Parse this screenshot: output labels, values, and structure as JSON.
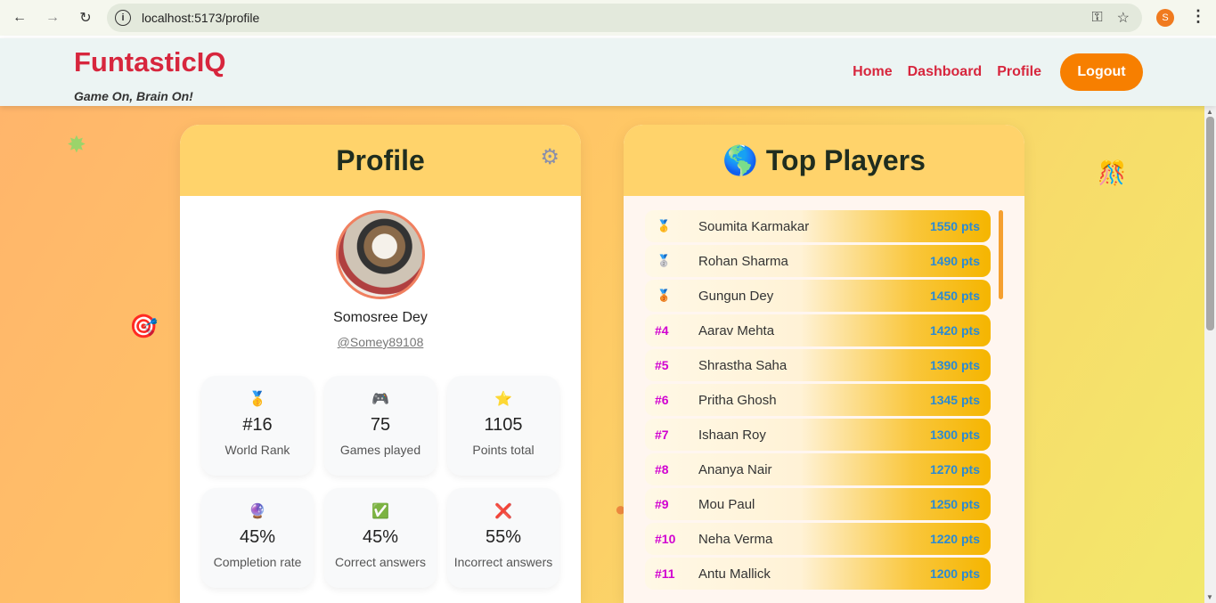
{
  "browser": {
    "url": "localhost:5173/profile",
    "profile_initial": "S"
  },
  "header": {
    "logo": "FuntasticIQ",
    "tagline": "Game On, Brain On!",
    "nav": [
      "Home",
      "Dashboard",
      "Profile"
    ],
    "logout": "Logout"
  },
  "profile": {
    "title": "Profile",
    "name": "Somosree Dey",
    "handle": "@Somey89108",
    "stats": [
      {
        "icon": "🥇",
        "value": "#16",
        "label": "World Rank"
      },
      {
        "icon": "🎮",
        "value": "75",
        "label": "Games played"
      },
      {
        "icon": "⭐",
        "value": "1105",
        "label": "Points total"
      },
      {
        "icon": "🔮",
        "value": "45%",
        "label": "Completion rate"
      },
      {
        "icon": "✅",
        "value": "45%",
        "label": "Correct answers"
      },
      {
        "icon": "❌",
        "value": "55%",
        "label": "Incorrect answers"
      }
    ]
  },
  "leaderboard": {
    "icon": "🌎",
    "title": "Top Players",
    "players": [
      {
        "rank": "🥇",
        "name": "Soumita Karmakar",
        "points": "1550 pts"
      },
      {
        "rank": "🥈",
        "name": "Rohan Sharma",
        "points": "1490 pts"
      },
      {
        "rank": "🥉",
        "name": "Gungun Dey",
        "points": "1450 pts"
      },
      {
        "rank": "#4",
        "name": "Aarav Mehta",
        "points": "1420 pts"
      },
      {
        "rank": "#5",
        "name": "Shrastha Saha",
        "points": "1390 pts"
      },
      {
        "rank": "#6",
        "name": "Pritha Ghosh",
        "points": "1345 pts"
      },
      {
        "rank": "#7",
        "name": "Ishaan Roy",
        "points": "1300 pts"
      },
      {
        "rank": "#8",
        "name": "Ananya Nair",
        "points": "1270 pts"
      },
      {
        "rank": "#9",
        "name": "Mou Paul",
        "points": "1250 pts"
      },
      {
        "rank": "#10",
        "name": "Neha Verma",
        "points": "1220 pts"
      },
      {
        "rank": "#11",
        "name": "Antu Mallick",
        "points": "1200 pts"
      }
    ]
  },
  "colors": {
    "brand_red": "#d7263d",
    "orange": "#f77f00",
    "gold": "#ffd36b",
    "blue_points": "#2a8ad4",
    "rank_magenta": "#d100d1"
  }
}
